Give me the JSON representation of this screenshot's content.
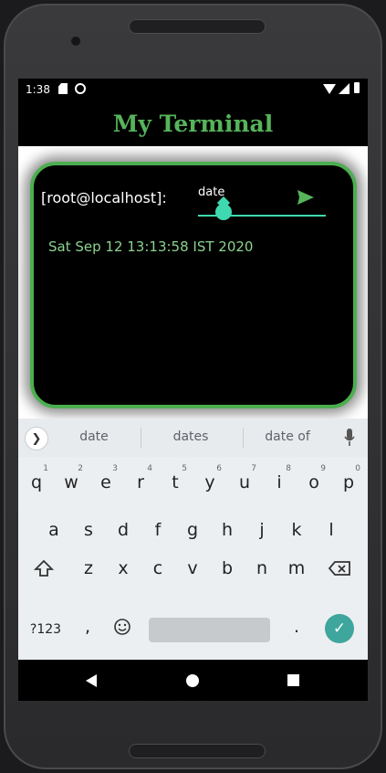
{
  "status": {
    "time": "1:38"
  },
  "app": {
    "title": "My Terminal"
  },
  "terminal": {
    "prompt": "[root@localhost]:",
    "input_value": "date",
    "output": "Sat Sep 12 13:13:58 IST 2020",
    "accent_color": "#3ed9b0",
    "border_color": "#4cae4f"
  },
  "keyboard": {
    "suggestions": [
      "date",
      "dates",
      "date of"
    ],
    "row1": [
      "q",
      "w",
      "e",
      "r",
      "t",
      "y",
      "u",
      "i",
      "o",
      "p"
    ],
    "row1_hints": [
      "1",
      "2",
      "3",
      "4",
      "5",
      "6",
      "7",
      "8",
      "9",
      "0"
    ],
    "row2": [
      "a",
      "s",
      "d",
      "f",
      "g",
      "h",
      "j",
      "k",
      "l"
    ],
    "row3": [
      "z",
      "x",
      "c",
      "v",
      "b",
      "n",
      "m"
    ],
    "symbols_label": "?123",
    "comma": ",",
    "period": "."
  },
  "icons": {
    "send": "send-icon",
    "mic": "microphone-icon",
    "shift": "shift-icon",
    "delete": "backspace-icon",
    "emoji": "emoji-icon",
    "enter": "check-icon"
  }
}
